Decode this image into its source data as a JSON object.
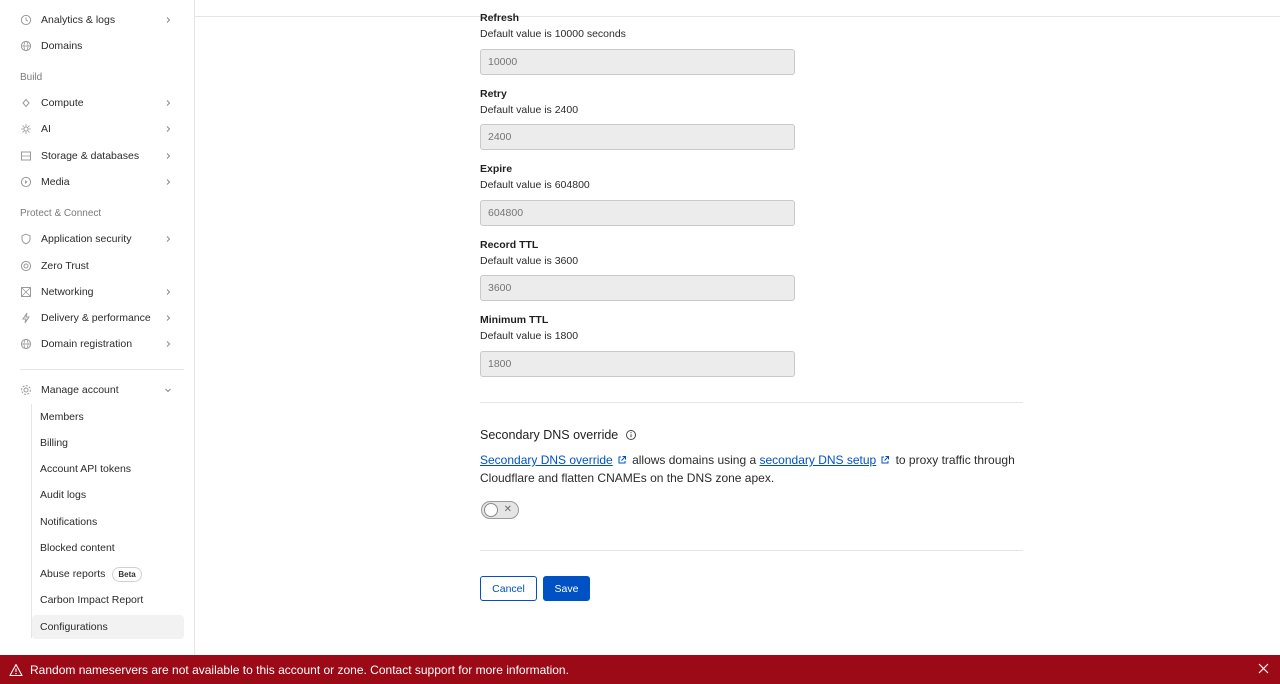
{
  "sidebar": {
    "items_top": [
      {
        "label": "Analytics & logs",
        "icon": "clock-icon",
        "has_chevron": true
      },
      {
        "label": "Domains",
        "icon": "globe-icon",
        "has_chevron": false
      }
    ],
    "section_build": "Build",
    "items_build": [
      {
        "label": "Compute",
        "icon": "compute-icon"
      },
      {
        "label": "AI",
        "icon": "ai-sparkle-icon"
      },
      {
        "label": "Storage & databases",
        "icon": "database-icon"
      },
      {
        "label": "Media",
        "icon": "media-icon"
      }
    ],
    "section_protect": "Protect & Connect",
    "items_protect": [
      {
        "label": "Application security",
        "icon": "shield-icon",
        "has_chevron": true
      },
      {
        "label": "Zero Trust",
        "icon": "zero-trust-icon",
        "has_chevron": false
      },
      {
        "label": "Networking",
        "icon": "network-icon",
        "has_chevron": true
      },
      {
        "label": "Delivery & performance",
        "icon": "bolt-icon",
        "has_chevron": true
      },
      {
        "label": "Domain registration",
        "icon": "globe-icon",
        "has_chevron": true
      }
    ],
    "manage_account": "Manage account",
    "manage_items": [
      {
        "label": "Members"
      },
      {
        "label": "Billing"
      },
      {
        "label": "Account API tokens"
      },
      {
        "label": "Audit logs"
      },
      {
        "label": "Notifications"
      },
      {
        "label": "Blocked content"
      },
      {
        "label": "Abuse reports",
        "badge": "Beta"
      },
      {
        "label": "Carbon Impact Report"
      },
      {
        "label": "Configurations",
        "active": true
      }
    ]
  },
  "fields": [
    {
      "label": "Refresh",
      "help": "Default value is 10000 seconds",
      "placeholder": "10000"
    },
    {
      "label": "Retry",
      "help": "Default value is 2400",
      "placeholder": "2400"
    },
    {
      "label": "Expire",
      "help": "Default value is 604800",
      "placeholder": "604800"
    },
    {
      "label": "Record TTL",
      "help": "Default value is 3600",
      "placeholder": "3600"
    },
    {
      "label": "Minimum TTL",
      "help": "Default value is 1800",
      "placeholder": "1800"
    }
  ],
  "secondary_dns": {
    "title": "Secondary DNS override",
    "link1": "Secondary DNS override",
    "text1": "allows domains using a",
    "link2": "secondary DNS setup",
    "text2": "to proxy traffic through Cloudflare and flatten CNAMEs on the DNS zone apex.",
    "toggle_on": false
  },
  "actions": {
    "cancel": "Cancel",
    "save": "Save"
  },
  "banner": {
    "message": "Random nameservers are not available to this account or zone. Contact support for more information.",
    "color": "#9b0a16"
  },
  "colors": {
    "accent": "#0051c3"
  }
}
